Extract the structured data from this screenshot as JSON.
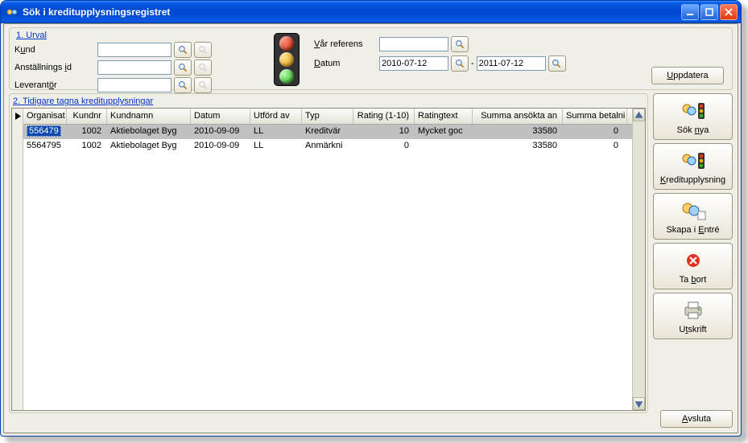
{
  "window": {
    "title": "Sök i kreditupplysningsregistret"
  },
  "section1": {
    "heading": "1. Urval",
    "kund": {
      "label_pre": "K",
      "label_ul": "u",
      "label_post": "nd"
    },
    "anst": {
      "label_pre": "Anställnings ",
      "label_ul": "i",
      "label_post": "d"
    },
    "lev": {
      "label_pre": "Leverant",
      "label_ul": "ö",
      "label_post": "r"
    },
    "varref": {
      "label_pre": "",
      "label_ul": "V",
      "label_post": "år referens"
    },
    "datum": {
      "label_pre": "",
      "label_ul": "D",
      "label_post": "atum",
      "from": "2010-07-12",
      "sep": "-",
      "to": "2011-07-12"
    },
    "update": {
      "pre": "",
      "ul": "U",
      "post": "ppdatera"
    }
  },
  "section2": {
    "heading": "2. Tidigare tagna kreditupplysningar",
    "columns": [
      "Organisat",
      "Kundnr",
      "Kundnamn",
      "Datum",
      "Utförd av",
      "Typ",
      "Rating (1-10)",
      "Ratingtext",
      "Summa ansökta an",
      "Summa betalni"
    ],
    "rows": [
      {
        "c0": "556479",
        "c1": "1002",
        "c2": "Aktiebolaget Byg",
        "c3": "2010-09-09",
        "c4": "LL",
        "c5": "Kreditvär",
        "c6": "10",
        "c7": "Mycket goc",
        "c8": "33580",
        "c9": "0",
        "selected": true
      },
      {
        "c0": "5564795",
        "c1": "1002",
        "c2": "Aktiebolaget Byg",
        "c3": "2010-09-09",
        "c4": "LL",
        "c5": "Anmärkni",
        "c6": "0",
        "c7": "",
        "c8": "33580",
        "c9": "0",
        "selected": false
      }
    ]
  },
  "actions": {
    "soknya": {
      "pre": "Sök ",
      "ul": "n",
      "post": "ya"
    },
    "kredit": {
      "pre": "",
      "ul": "K",
      "post": "reditupplysning"
    },
    "skapa": {
      "pre": "Skapa i ",
      "ul": "E",
      "post": "ntré"
    },
    "tabort": {
      "pre": "Ta ",
      "ul": "b",
      "post": "ort"
    },
    "utskrift": {
      "pre": "U",
      "ul": "t",
      "post": "skrift"
    },
    "avsluta": {
      "pre": "",
      "ul": "A",
      "post": "vsluta"
    }
  },
  "colors": {
    "link": "#0033cc",
    "titlebar": "#0049d0"
  }
}
